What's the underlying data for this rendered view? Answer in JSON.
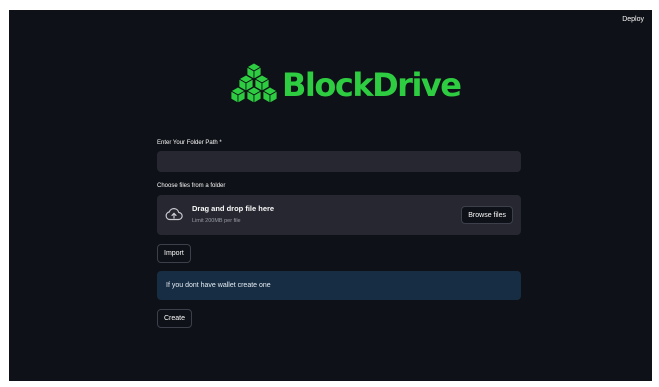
{
  "header": {
    "deploy_label": "Deploy"
  },
  "logo": {
    "text": "BlockDrive",
    "icon": "cubes-icon",
    "color": "#2ecc40"
  },
  "folder_path": {
    "label": "Enter Your Folder Path *",
    "value": "",
    "placeholder": ""
  },
  "uploader": {
    "label": "Choose files from a folder",
    "title": "Drag and drop file here",
    "limit": "Limit 200MB per file",
    "browse_label": "Browse files",
    "icon": "cloud-upload-icon"
  },
  "import_label": "Import",
  "info": {
    "message": "If you dont have wallet create one"
  },
  "create_label": "Create",
  "colors": {
    "background": "#0e1117",
    "input_bg": "#262730",
    "info_bg": "#172d43",
    "text": "#fafafa"
  }
}
